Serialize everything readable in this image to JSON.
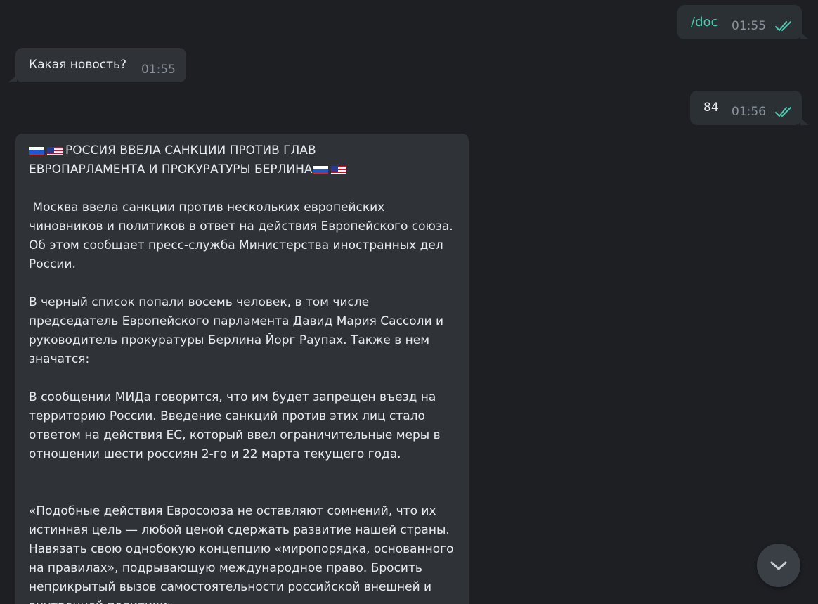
{
  "messages": [
    {
      "text": "/doc",
      "time": "01:55"
    },
    {
      "text": "Какая новость?",
      "time": "01:55"
    },
    {
      "text": "84",
      "time": "01:56"
    }
  ],
  "post": {
    "title_line1": "РОССИЯ ВВЕЛА САНКЦИИ ПРОТИВ ГЛАВ",
    "title_line2": "ЕВРОПАРЛАМЕНТА И ПРОКУРАТУРЫ БЕРЛИНА",
    "p1": " Москва ввела санкции против нескольких европейских чиновников и политиков в ответ на действия Европейского союза. Об этом сообщает пресс-служба Министерства иностранных дел России.",
    "p2": "В черный список попали восемь человек, в том числе председатель Европейского парламента Давид Мария Сассоли и руководитель прокуратуры Берлина Йорг Раупах. Также в нем значатся:",
    "p3": "В сообщении МИДа говорится, что им будет запрещен въезд на территорию России. Введение санкций против этих лиц стало ответом на действия ЕС, который ввел ограничительные меры в отношении шести россиян 2-го и 22 марта текущего года.",
    "p4": "«Подобные действия Евросоюза не оставляют сомнений, что их истинная цель — любой ценой сдержать развитие нашей страны. Навязать свою однобокую концепцию «миропорядка, основанного на правилах», подрывающую международное право. Бросить неприкрытый вызов самостоятельности российской внешней и внутренней политики»"
  },
  "icons": {
    "read_receipt": "double-check-icon",
    "flag_ru": "russia-flag-icon",
    "flag_us": "usa-flag-icon",
    "scroll_down": "chevron-down-icon"
  },
  "colors": {
    "background": "#1d1f23",
    "bubble": "#2f3338",
    "accent": "#4fc8ae",
    "timestamp": "#8a9299"
  }
}
